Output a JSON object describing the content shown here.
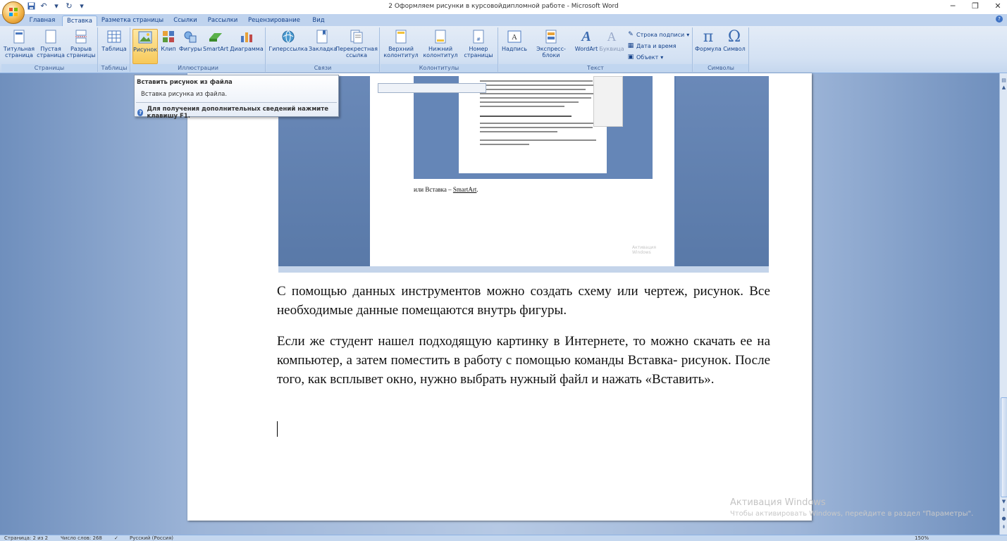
{
  "window": {
    "title": "2 Оформляем рисунки в курсовойдипломной работе - Microsoft Word",
    "minimize": "─",
    "maximize": "❐",
    "close": "✕"
  },
  "qat": {
    "save_icon": "save-icon",
    "undo_icon": "undo-icon",
    "redo_icon": "redo-icon",
    "customize": "▾"
  },
  "tabs": [
    {
      "label": "Главная"
    },
    {
      "label": "Вставка"
    },
    {
      "label": "Разметка страницы"
    },
    {
      "label": "Ссылки"
    },
    {
      "label": "Рассылки"
    },
    {
      "label": "Рецензирование"
    },
    {
      "label": "Вид"
    }
  ],
  "ribbon": {
    "pages": {
      "label": "Страницы",
      "title_page": "Титульная страница",
      "blank_page": "Пустая страница",
      "page_break": "Разрыв страницы"
    },
    "tables": {
      "label": "Таблицы",
      "table": "Таблица"
    },
    "illustrations": {
      "label": "Иллюстрации",
      "picture": "Рисунок",
      "clip": "Клип",
      "shapes": "Фигуры",
      "smartart": "SmartArt",
      "chart": "Диаграмма"
    },
    "links": {
      "label": "Связи",
      "hyperlink": "Гиперссылка",
      "bookmark": "Закладка",
      "cross_ref": "Перекрестная ссылка"
    },
    "header_footer": {
      "label": "Колонтитулы",
      "header": "Верхний колонтитул",
      "footer": "Нижний колонтитул",
      "page_number": "Номер страницы"
    },
    "text": {
      "label": "Текст",
      "textbox": "Надпись",
      "quick_parts": "Экспресс-блоки",
      "wordart": "WordArt",
      "dropcap": "Буквица",
      "signature_line": "Строка подписи",
      "date_time": "Дата и время",
      "object": "Объект"
    },
    "symbols": {
      "label": "Символы",
      "equation": "Формула",
      "symbol": "Символ"
    }
  },
  "tooltip": {
    "title": "Вставить рисунок из файла",
    "description": "Вставка рисунка из файла.",
    "help": "Для получения дополнительных сведений нажмите клавишу F1."
  },
  "document": {
    "embedded_caption_prefix": "или Вставка – ",
    "embedded_caption_link": "SmartArt",
    "embedded_caption_suffix": ".",
    "embedded_watermark": "Активация Windows",
    "paragraph1": "С помощью данных инструментов можно создать схему или чертеж, рисунок. Все необходимые данные помещаются внутрь фигуры.",
    "paragraph2": "Если же студент нашел подходящую картинку в Интернете, то можно скачать ее на компьютер, а  затем поместить в работу с помощью команды Вставка- рисунок. После того, как всплывет окно, нужно выбрать нужный файл и нажать «Вставить»."
  },
  "watermark": {
    "line1": "Активация Windows",
    "line2": "Чтобы активировать Windows, перейдите в раздел \"Параметры\"."
  },
  "statusbar": {
    "page": "Страница: 2 из 2",
    "words": "Число слов: 268",
    "language": "Русский (Россия)",
    "zoom": "150%"
  }
}
